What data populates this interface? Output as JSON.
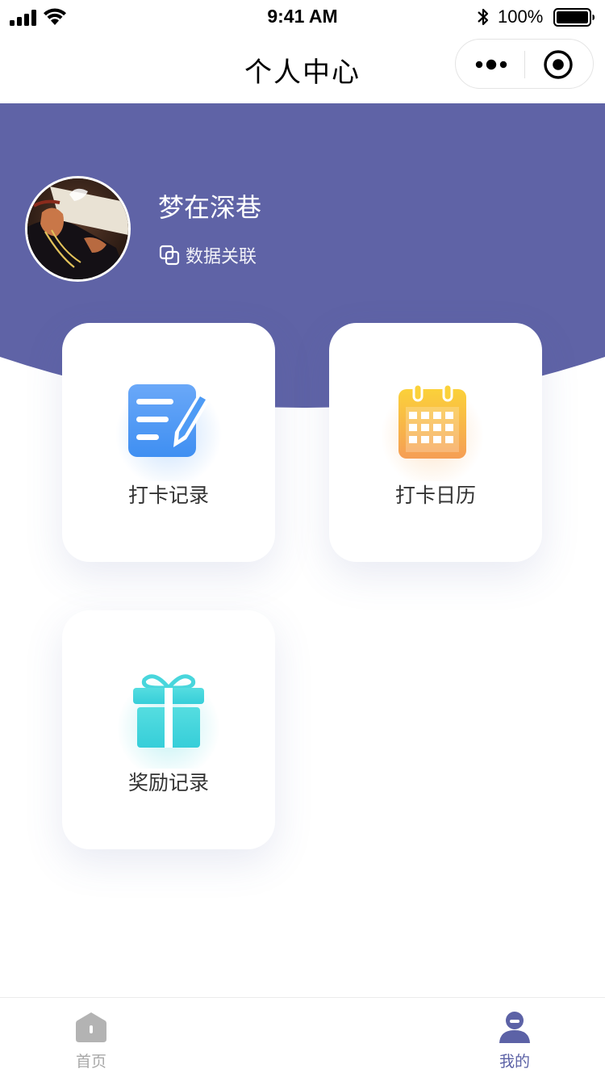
{
  "status_bar": {
    "time": "9:41 AM",
    "battery": "100%"
  },
  "nav": {
    "title": "个人中心",
    "more_icon": "more-dots-icon",
    "target_icon": "target-circle-icon"
  },
  "profile": {
    "username": "梦在深巷",
    "link_label": "数据关联",
    "link_icon": "copy-link-icon"
  },
  "cards": [
    {
      "label": "打卡记录",
      "icon": "notepad-edit-icon"
    },
    {
      "label": "打卡日历",
      "icon": "calendar-icon"
    },
    {
      "label": "奖励记录",
      "icon": "gift-icon"
    }
  ],
  "tab_bar": {
    "items": [
      {
        "label": "首页",
        "icon": "home-icon",
        "active": false
      },
      {
        "label": "我的",
        "icon": "user-icon",
        "active": true
      }
    ]
  },
  "colors": {
    "header_purple": "#5f63a6",
    "active_tab": "#5c62a6",
    "inactive_tab": "#a8a8a8",
    "notepad_blue": "#4e9bf5",
    "calendar_orange": "#f8a44a",
    "gift_cyan": "#40d4db"
  }
}
